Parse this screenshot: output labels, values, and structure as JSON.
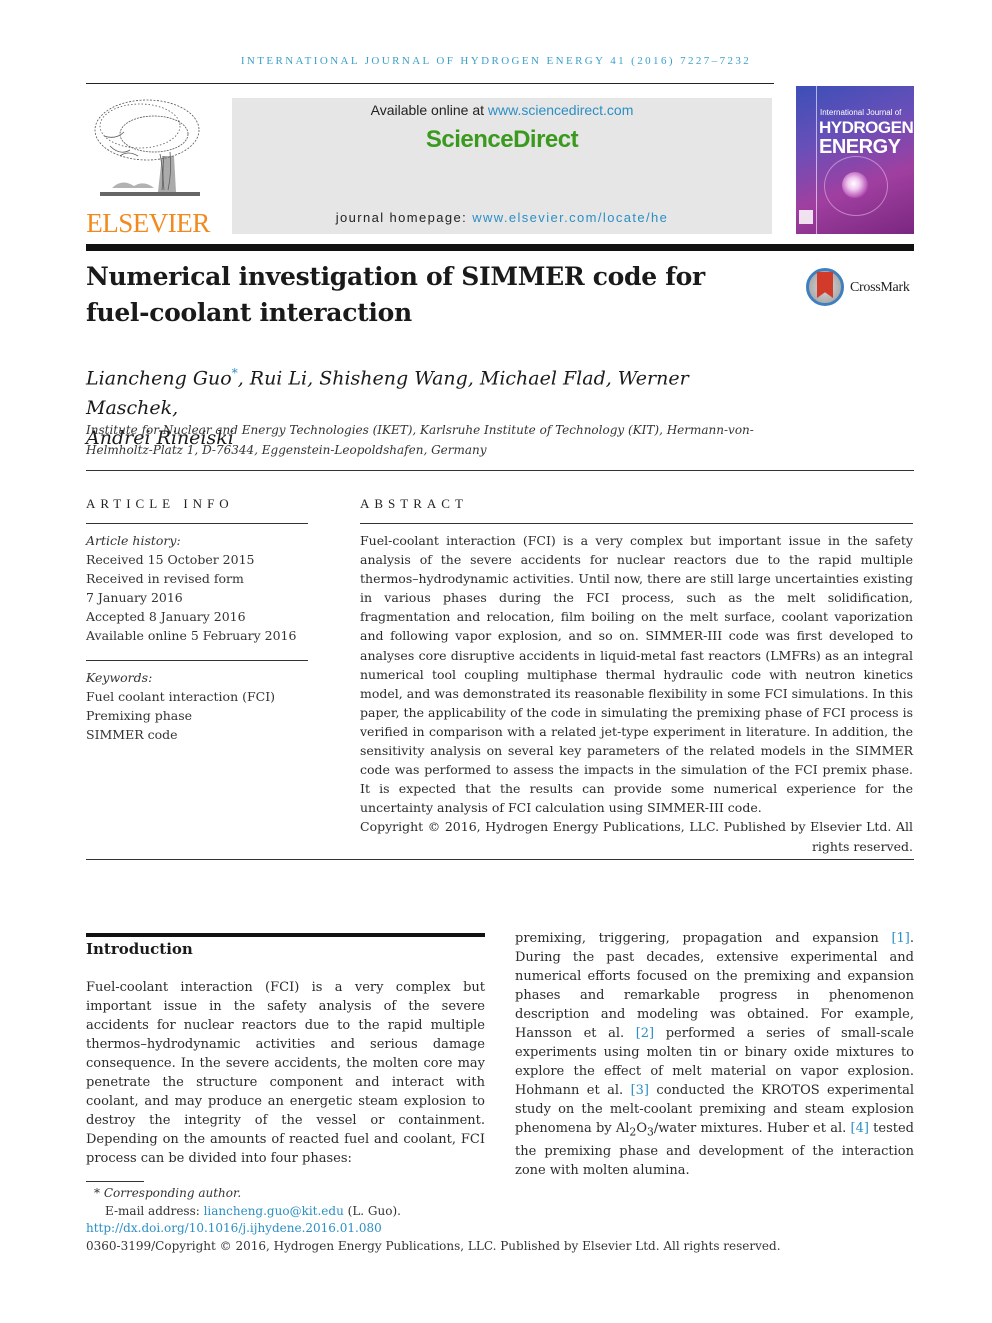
{
  "running_head": "International Journal of Hydrogen Energy 41 (2016) 7227–7232",
  "masthead": {
    "publisher_logo_text": "ELSEVIER",
    "available_online_prefix": "Available online at ",
    "available_online_link": "www.sciencedirect.com",
    "brand": "ScienceDirect",
    "homepage_prefix": "journal homepage: ",
    "homepage_link": "www.elsevier.com/locate/he",
    "cover": {
      "line1": "International Journal of",
      "line2": "HYDROGEN",
      "line3": "ENERGY"
    },
    "colors": {
      "elsevier_orange": "#f08a1e",
      "sciencedirect_green": "#3a9a1e",
      "link_blue": "#2b8fc5",
      "masthead_gray": "#e6e6e6"
    }
  },
  "article": {
    "title": "Numerical investigation of SIMMER code for fuel-coolant interaction",
    "crossmark_label": "CrossMark",
    "authors_line1_first": "Liancheng Guo",
    "authors_corresponding_mark": "*",
    "authors_line1_rest": ", Rui Li, Shisheng Wang, Michael Flad, Werner Maschek,",
    "authors_line2": "Andrei Rineiski",
    "affiliation": "Institute for Nuclear and Energy Technologies (IKET), Karlsruhe Institute of Technology (KIT), Hermann-von-Helmholtz-Platz 1, D-76344, Eggenstein-Leopoldshafen, Germany"
  },
  "article_info": {
    "heading": "ARTICLE INFO",
    "history_label": "Article history:",
    "history": [
      "Received 15 October 2015",
      "Received in revised form",
      "7 January 2016",
      "Accepted 8 January 2016",
      "Available online 5 February 2016"
    ],
    "keywords_label": "Keywords:",
    "keywords": [
      "Fuel coolant interaction (FCI)",
      "Premixing phase",
      "SIMMER code"
    ]
  },
  "abstract": {
    "heading": "ABSTRACT",
    "text": "Fuel-coolant interaction (FCI) is a very complex but important issue in the safety analysis of the severe accidents for nuclear reactors due to the rapid multiple thermos–hydrodynamic activities. Until now, there are still large uncertainties existing in various phases during the FCI process, such as the melt solidification, fragmentation and relocation, film boiling on the melt surface, coolant vaporization and following vapor explosion, and so on. SIMMER-III code was first developed to analyses core disruptive accidents in liquid-metal fast reactors (LMFRs) as an integral numerical tool coupling multiphase thermal hydraulic code with neutron kinetics model, and was demonstrated its reasonable flexibility in some FCI simulations. In this paper, the applicability of the code in simulating the premixing phase of FCI process is verified in comparison with a related jet-type experiment in literature. In addition, the sensitivity analysis on several key parameters of the related models in the SIMMER code was performed to assess the impacts in the simulation of the FCI premix phase. It is expected that the results can provide some numerical experience for the uncertainty analysis of FCI calculation using SIMMER-III code.",
    "copyright": "Copyright © 2016, Hydrogen Energy Publications, LLC. Published by Elsevier Ltd. All rights reserved."
  },
  "introduction": {
    "heading": "Introduction",
    "left_text": "Fuel-coolant interaction (FCI) is a very complex but important issue in the safety analysis of the severe accidents for nuclear reactors due to the rapid multiple thermos–hydrodynamic activities and serious damage consequence. In the severe accidents, the molten core may penetrate the structure component and interact with coolant, and may produce an energetic steam explosion to destroy the integrity of the vessel or containment. Depending on the amounts of reacted fuel and coolant, FCI process can be divided into four phases:",
    "right": {
      "t1": "premixing, triggering, propagation and expansion ",
      "ref1": "[1]",
      "t2": ". During the past decades, extensive experimental and numerical efforts focused on the premixing and expansion phases and remarkable progress in phenomenon description and modeling was obtained. For example, Hansson et al. ",
      "ref2": "[2]",
      "t3": " performed a series of small-scale experiments using molten tin or binary oxide mixtures to explore the effect of melt material on vapor explosion. Hohmann et al. ",
      "ref3": "[3]",
      "t4": " conducted the KROTOS experimental study on the melt-coolant premixing and steam explosion phenomena by Al",
      "sub2": "2",
      "t4b": "O",
      "sub3": "3",
      "t5": "/water mixtures. Huber et al. ",
      "ref4": "[4]",
      "t6": " tested the premixing phase and development of the interaction zone with molten alumina."
    }
  },
  "footnotes": {
    "corresponding_mark": "*",
    "corresponding_label": "Corresponding author.",
    "email_label": "E-mail address: ",
    "email": "liancheng.guo@kit.edu",
    "email_suffix": " (L. Guo).",
    "doi": "http://dx.doi.org/10.1016/j.ijhydene.2016.01.080",
    "issn_copyright": "0360-3199/Copyright © 2016, Hydrogen Energy Publications, LLC. Published by Elsevier Ltd. All rights reserved."
  }
}
